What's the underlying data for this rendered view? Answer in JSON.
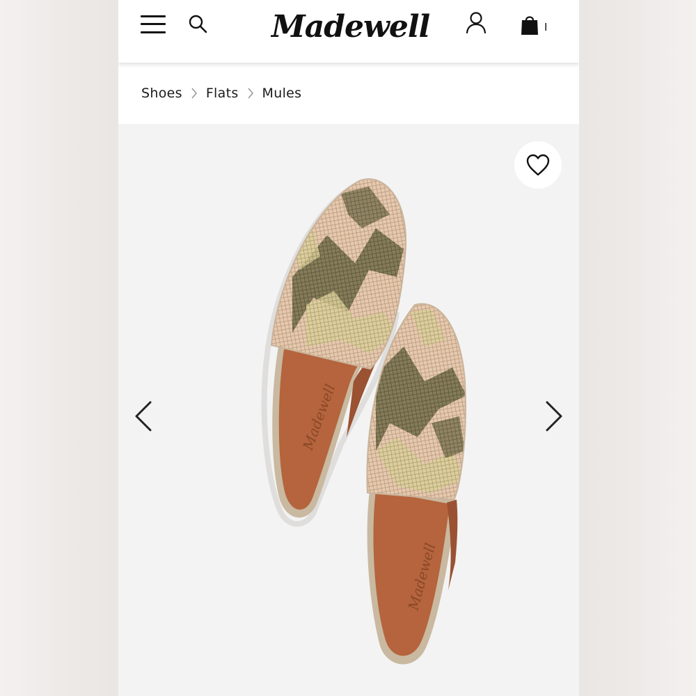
{
  "header": {
    "logo_text": "Madewell",
    "bag_count": "I",
    "icons": [
      "menu-icon",
      "search-icon",
      "account-icon",
      "bag-icon"
    ]
  },
  "breadcrumb": {
    "items": [
      "Shoes",
      "Flats",
      "Mules"
    ]
  },
  "gallery": {
    "icons": [
      "heart-icon",
      "chevron-left-icon",
      "chevron-right-icon"
    ],
    "insole_brand": "Madewell"
  },
  "colors": {
    "header_bg": "#ffffff",
    "gallery_bg": "#f3f3f3",
    "icon": "#111111",
    "leather": "#b5643d",
    "snakeskin_light": "#e8c9b0",
    "snakeskin_dark": "#6e6a4b"
  }
}
